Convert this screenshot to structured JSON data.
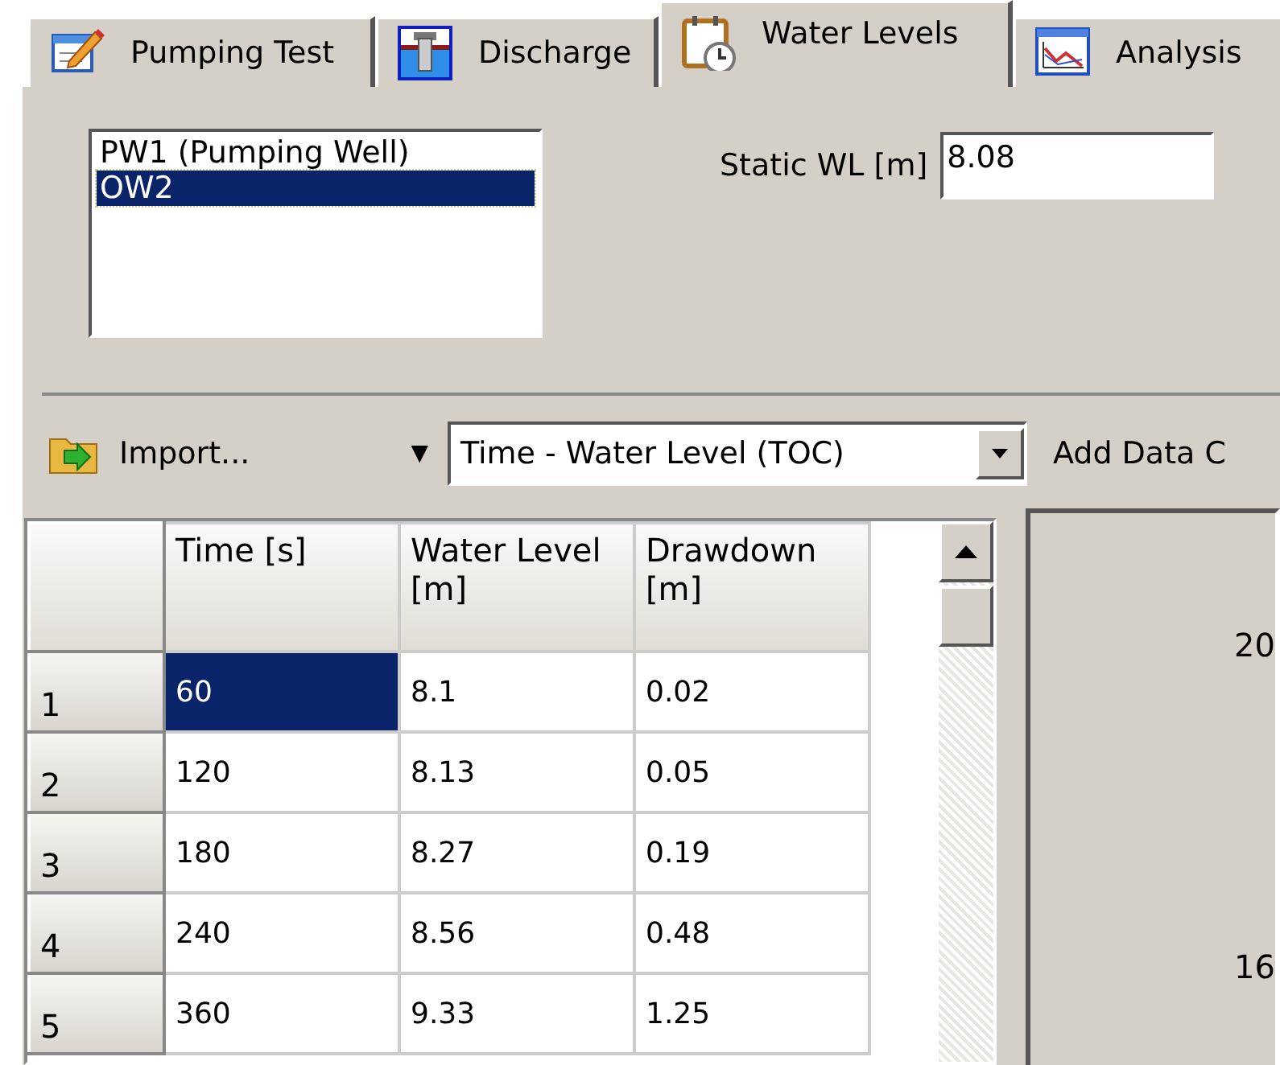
{
  "tabs": [
    {
      "label": "Pumping Test",
      "kind": "notepad",
      "selected": false
    },
    {
      "label": "Discharge",
      "kind": "pump",
      "selected": false
    },
    {
      "label": "Water Levels",
      "kind": "calendar",
      "selected": true
    },
    {
      "label": "Analysis",
      "kind": "chart",
      "selected": false
    }
  ],
  "wells": [
    {
      "label": "PW1 (Pumping Well)",
      "selected": false
    },
    {
      "label": "OW2",
      "selected": true
    }
  ],
  "static_wl": {
    "label": "Static WL [m]",
    "value": "8.08"
  },
  "toolbar": {
    "import_label": "Import...",
    "dropdown_arrow": "▼",
    "data_type": "Time - Water Level (TOC)",
    "add_label": "Add Data C"
  },
  "table": {
    "columns": [
      "Time [s]",
      "Water Level [m]",
      "Drawdown [m]"
    ],
    "rows": [
      {
        "number": "1",
        "cells": [
          {
            "text": "60",
            "selected": true
          },
          {
            "text": "8.1",
            "selected": false
          },
          {
            "text": "0.02",
            "selected": false
          }
        ]
      },
      {
        "number": "2",
        "cells": [
          {
            "text": "120",
            "selected": false
          },
          {
            "text": "8.13",
            "selected": false
          },
          {
            "text": "0.05",
            "selected": false
          }
        ]
      },
      {
        "number": "3",
        "cells": [
          {
            "text": "180",
            "selected": false
          },
          {
            "text": "8.27",
            "selected": false
          },
          {
            "text": "0.19",
            "selected": false
          }
        ]
      },
      {
        "number": "4",
        "cells": [
          {
            "text": "240",
            "selected": false
          },
          {
            "text": "8.56",
            "selected": false
          },
          {
            "text": "0.48",
            "selected": false
          }
        ]
      },
      {
        "number": "5",
        "cells": [
          {
            "text": "360",
            "selected": false
          },
          {
            "text": "9.33",
            "selected": false
          },
          {
            "text": "1.25",
            "selected": false
          }
        ]
      }
    ]
  },
  "chart": {
    "tick_labels": [
      "20",
      "16"
    ]
  }
}
